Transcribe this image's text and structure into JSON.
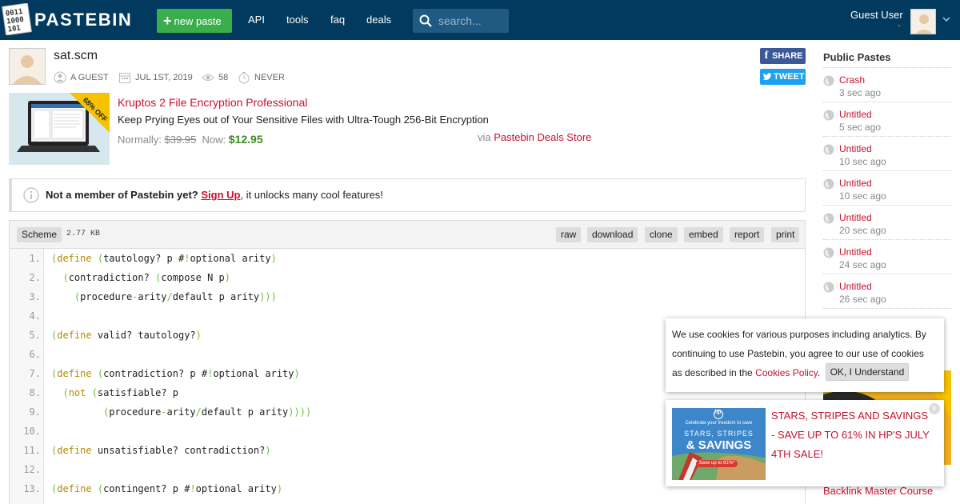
{
  "header": {
    "logo_text": "PASTEBIN",
    "new_paste": "new paste",
    "nav": [
      "API",
      "tools",
      "faq",
      "deals"
    ],
    "search_placeholder": "search...",
    "user_name": "Guest User",
    "user_sub": "-"
  },
  "paste": {
    "title": "sat.scm",
    "author": "A GUEST",
    "date": "JUL 1ST, 2019",
    "views": "58",
    "expiry": "NEVER",
    "share_label": "SHARE",
    "tweet_label": "TWEET"
  },
  "deal": {
    "badge": "68% OFF",
    "title": "Kruptos 2 File Encryption Professional",
    "description": "Keep Prying Eyes out of Your Sensitive Files with Ultra-Tough 256-Bit Encryption",
    "normally_label": "Normally:",
    "old_price": "$39.95",
    "now_label": "Now:",
    "new_price": "$12.95",
    "via_label": "via",
    "via_store": "Pastebin Deals Store"
  },
  "notice": {
    "lead": "Not a member of Pastebin yet?",
    "link": "Sign Up",
    "rest": ", it unlocks many cool features!"
  },
  "code": {
    "scheme": "Scheme",
    "size": "2.77 KB",
    "tools": [
      "raw",
      "download",
      "clone",
      "embed",
      "report",
      "print"
    ],
    "line_numbers": [
      "1.",
      "2.",
      "3.",
      "4.",
      "5.",
      "6.",
      "7.",
      "8.",
      "9.",
      "10.",
      "11.",
      "12.",
      "13."
    ]
  },
  "sidebar": {
    "title": "Public Pastes",
    "items": [
      {
        "title": "Crash",
        "age": "3 sec ago"
      },
      {
        "title": "Untitled",
        "age": "5 sec ago"
      },
      {
        "title": "Untitled",
        "age": "10 sec ago"
      },
      {
        "title": "Untitled",
        "age": "10 sec ago"
      },
      {
        "title": "Untitled",
        "age": "20 sec ago"
      },
      {
        "title": "Untitled",
        "age": "24 sec ago"
      },
      {
        "title": "Untitled",
        "age": "26 sec ago"
      }
    ],
    "backlink": "Backlink Master Course"
  },
  "cookie": {
    "text": "We use cookies for various purposes including analytics. By continuing to use Pastebin, you agree to our use of cookies as described in the",
    "link": "Cookies Policy",
    "ok": "OK, I Understand"
  },
  "promo": {
    "text": "STARS, STRIPES AND SAVINGS - SAVE UP TO 61% IN HP'S JULY 4TH SALE!",
    "image_brand": "hp",
    "image_tagline": "Celebrate your freedom to save",
    "image_headline_1": "STARS, STRIPES",
    "image_headline_2": "& SAVINGS",
    "image_pill": "Save up to 61%*"
  },
  "colors": {
    "header_bg": "#02395e",
    "accent_green": "#3aae4c",
    "link_red": "#c8102e",
    "keyword": "#b58900",
    "paren": "#6bbf3a"
  }
}
